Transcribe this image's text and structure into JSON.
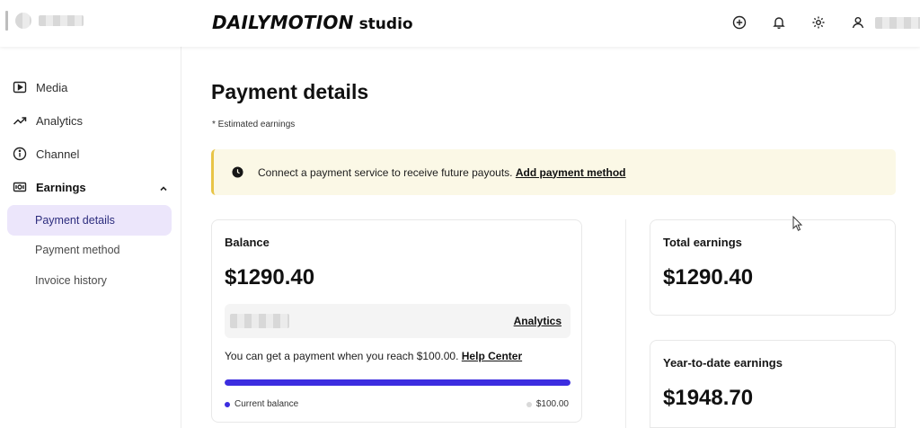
{
  "brand": {
    "logo_text": "DAILYMOTION",
    "suffix": "studio"
  },
  "top_icons": [
    "add-icon",
    "bell-icon",
    "gear-icon",
    "user-icon"
  ],
  "sidebar": {
    "items": [
      {
        "label": "Media",
        "icon": "media-icon"
      },
      {
        "label": "Analytics",
        "icon": "analytics-icon"
      },
      {
        "label": "Channel",
        "icon": "info-icon"
      },
      {
        "label": "Earnings",
        "icon": "earnings-icon",
        "expanded": true
      }
    ],
    "earnings_sub": [
      {
        "label": "Payment details",
        "active": true
      },
      {
        "label": "Payment method",
        "active": false
      },
      {
        "label": "Invoice history",
        "active": false
      }
    ]
  },
  "main": {
    "title": "Payment details",
    "note": "* Estimated earnings",
    "alert": {
      "text": "Connect a payment service to receive future payouts.",
      "link": "Add payment method"
    },
    "balance": {
      "title": "Balance",
      "amount": "$1290.40",
      "analytics_link": "Analytics",
      "payment_note": "You can get a payment when you reach $100.00.",
      "help_link": "Help Center",
      "progress_percent": 100,
      "legend_current": "Current balance",
      "legend_threshold": "$100.00"
    },
    "total": {
      "title": "Total earnings",
      "amount": "$1290.40"
    },
    "ytd": {
      "title": "Year-to-date earnings",
      "amount": "$1948.70"
    }
  },
  "colors": {
    "accent": "#3c2de0",
    "active_nav_bg": "#ece6fb",
    "alert_bg": "#fbf8e6",
    "alert_border": "#e8c547"
  }
}
